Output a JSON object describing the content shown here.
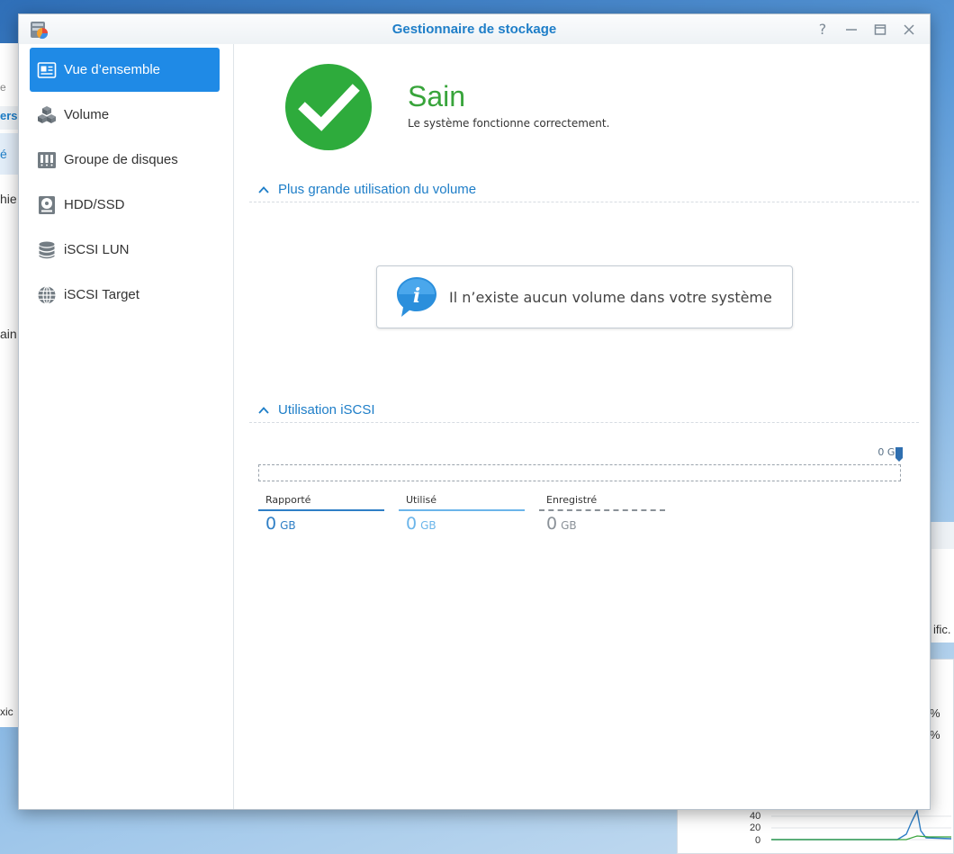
{
  "window": {
    "title": "Gestionnaire de stockage",
    "controls": [
      "help-icon",
      "minimize-icon",
      "maximize-icon",
      "close-icon"
    ]
  },
  "sidebar": {
    "items": [
      {
        "label": "Vue d’ensemble",
        "icon": "overview-icon",
        "active": true
      },
      {
        "label": "Volume",
        "icon": "volume-icon",
        "active": false
      },
      {
        "label": "Groupe de disques",
        "icon": "disk-group-icon",
        "active": false
      },
      {
        "label": "HDD/SSD",
        "icon": "hdd-icon",
        "active": false
      },
      {
        "label": "iSCSI LUN",
        "icon": "database-icon",
        "active": false
      },
      {
        "label": "iSCSI Target",
        "icon": "globe-icon",
        "active": false
      }
    ]
  },
  "status": {
    "title": "Sain",
    "description": "Le système fonctionne correctement.",
    "color": "#38a43b"
  },
  "volume_section": {
    "title": "Plus grande utilisation du volume",
    "info_message": "Il n’existe aucun volume dans votre système"
  },
  "iscsi_section": {
    "title": "Utilisation iSCSI",
    "capacity_label": "0 GB",
    "legend": [
      {
        "label": "Rapporté",
        "value": "0",
        "unit": "GB",
        "color": "#2f7fc6"
      },
      {
        "label": "Utilisé",
        "value": "0",
        "unit": "GB",
        "color": "#6bb5ea"
      },
      {
        "label": "Enregistré",
        "value": "0",
        "unit": "GB",
        "color": "#8a9198"
      }
    ]
  },
  "background": {
    "left_fragments": [
      "e",
      "ers",
      "é",
      "hie",
      "ain",
      "xic"
    ],
    "right_fragments": [
      "ific.",
      "%",
      "%"
    ],
    "chart_axis": [
      "40",
      "20",
      "0"
    ]
  },
  "accent_color": "#1f8ae6"
}
